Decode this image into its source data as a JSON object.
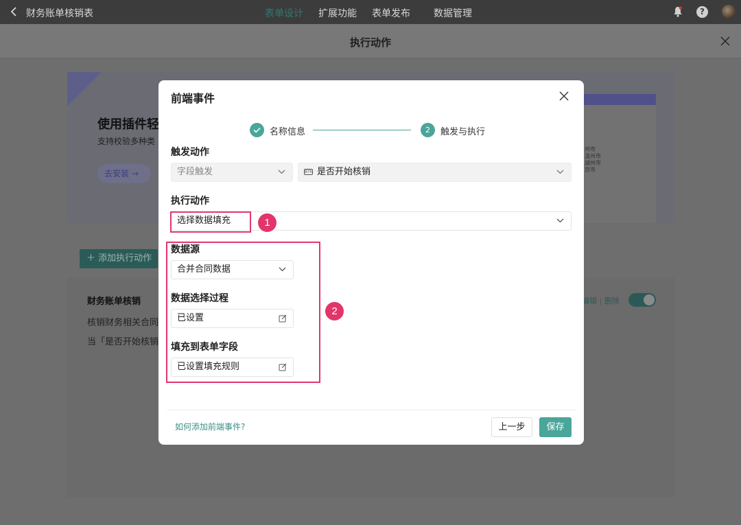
{
  "topbar": {
    "app_title": "财务账单核销表",
    "nav": [
      "表单设计",
      "扩展功能",
      "表单发布",
      "数据管理"
    ],
    "help_glyph": "?",
    "accent": "#2e7a73"
  },
  "page": {
    "title": "执行动作",
    "banner": {
      "heading": "使用插件轻",
      "sub": "支持校验多种类",
      "install_label": "去安装 →",
      "mock_lines": [
        "州市",
        "温州市",
        "湖州市",
        "京市"
      ]
    },
    "add_action_label": "＋ 添加执行动作",
    "action_card": {
      "name": "财务账单核销",
      "desc": "核销财务相关合同",
      "rule": "当「是否开始核销」",
      "edit_label": "编辑",
      "delete_label": "删除"
    }
  },
  "modal": {
    "title": "前端事件",
    "steps": [
      {
        "label": "名称信息",
        "status": "done"
      },
      {
        "num": "2",
        "label": "触发与执行",
        "status": "active"
      }
    ],
    "trigger": {
      "section_label": "触发动作",
      "type_value": "字段触发",
      "field_icon": "BTN",
      "field_value": "是否开始核销"
    },
    "action": {
      "section_label": "执行动作",
      "value": "选择数据填充"
    },
    "data_source": {
      "section_label": "数据源",
      "value": "合并合同数据"
    },
    "select_process": {
      "section_label": "数据选择过程",
      "value": "已设置"
    },
    "fill_fields": {
      "section_label": "填充到表单字段",
      "value": "已设置填充规则"
    },
    "callouts": [
      "1",
      "2"
    ],
    "help_link": "如何添加前端事件?",
    "prev_label": "上一步",
    "save_label": "保存",
    "primary_color": "#4aa59a",
    "highlight_color": "#e2356a"
  }
}
